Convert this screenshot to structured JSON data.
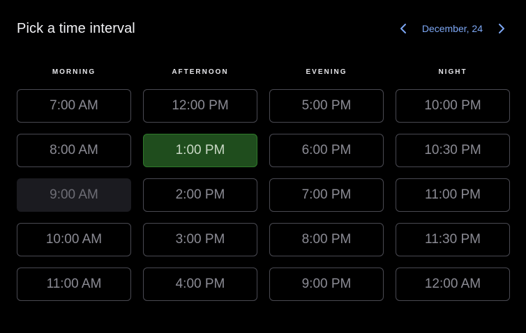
{
  "header": {
    "title": "Pick a time interval",
    "date": "December, 24",
    "prev_icon": "chevron-left-icon",
    "next_icon": "chevron-right-icon"
  },
  "colors": {
    "background": "#000000",
    "accent": "#7da7f4",
    "selected_bg": "#1f4d1d",
    "selected_border": "#2f7a2a",
    "slot_border": "#4a4a52",
    "disabled_bg": "#1b1b20"
  },
  "columns": [
    {
      "label": "MORNING",
      "slots": [
        {
          "time": "7:00 AM",
          "state": "available"
        },
        {
          "time": "8:00 AM",
          "state": "available"
        },
        {
          "time": "9:00 AM",
          "state": "disabled"
        },
        {
          "time": "10:00 AM",
          "state": "available"
        },
        {
          "time": "11:00 AM",
          "state": "available"
        }
      ]
    },
    {
      "label": "AFTERNOON",
      "slots": [
        {
          "time": "12:00 PM",
          "state": "available"
        },
        {
          "time": "1:00 PM",
          "state": "selected"
        },
        {
          "time": "2:00 PM",
          "state": "available"
        },
        {
          "time": "3:00 PM",
          "state": "available"
        },
        {
          "time": "4:00 PM",
          "state": "available"
        }
      ]
    },
    {
      "label": "EVENING",
      "slots": [
        {
          "time": "5:00 PM",
          "state": "available"
        },
        {
          "time": "6:00 PM",
          "state": "available"
        },
        {
          "time": "7:00 PM",
          "state": "available"
        },
        {
          "time": "8:00 PM",
          "state": "available"
        },
        {
          "time": "9:00 PM",
          "state": "available"
        }
      ]
    },
    {
      "label": "NIGHT",
      "slots": [
        {
          "time": "10:00 PM",
          "state": "available"
        },
        {
          "time": "10:30 PM",
          "state": "available"
        },
        {
          "time": "11:00 PM",
          "state": "available"
        },
        {
          "time": "11:30 PM",
          "state": "available"
        },
        {
          "time": "12:00 AM",
          "state": "available"
        }
      ]
    }
  ]
}
